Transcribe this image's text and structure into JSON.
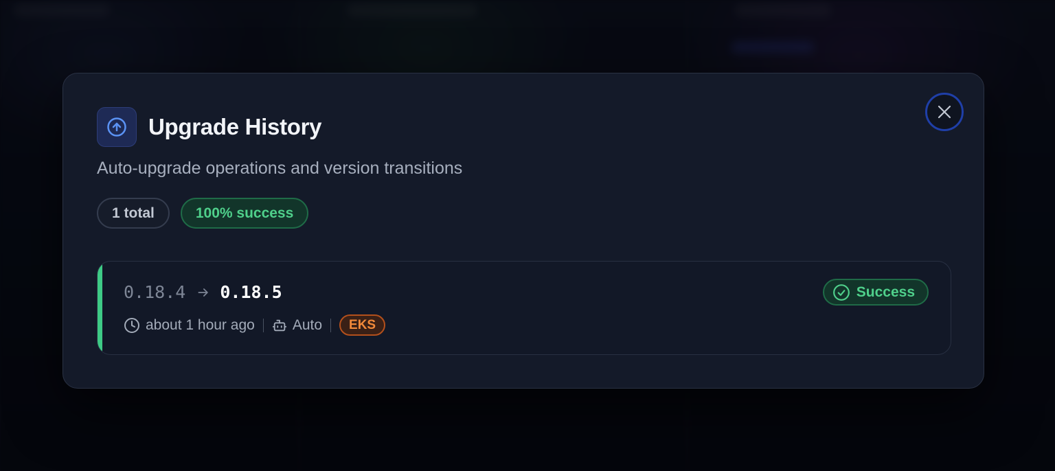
{
  "modal": {
    "title": "Upgrade History",
    "title_icon": "arrow-up-circle-icon",
    "subtitle": "Auto-upgrade operations and version transitions",
    "close_icon": "close-icon",
    "badges": {
      "total": "1 total",
      "success_rate": "100% success"
    },
    "entries": [
      {
        "from_version": "0.18.4",
        "to_version": "0.18.5",
        "arrow_icon": "arrow-right-icon",
        "time_icon": "clock-icon",
        "time": "about 1 hour ago",
        "trigger_icon": "bot-icon",
        "trigger": "Auto",
        "platform": "EKS",
        "status_icon": "check-circle-icon",
        "status": "Success"
      }
    ]
  },
  "colors": {
    "accent_blue": "#3b82f6",
    "success_green": "#4fd08b",
    "platform_orange": "#f28a3a",
    "modal_bg": "#141a29"
  }
}
